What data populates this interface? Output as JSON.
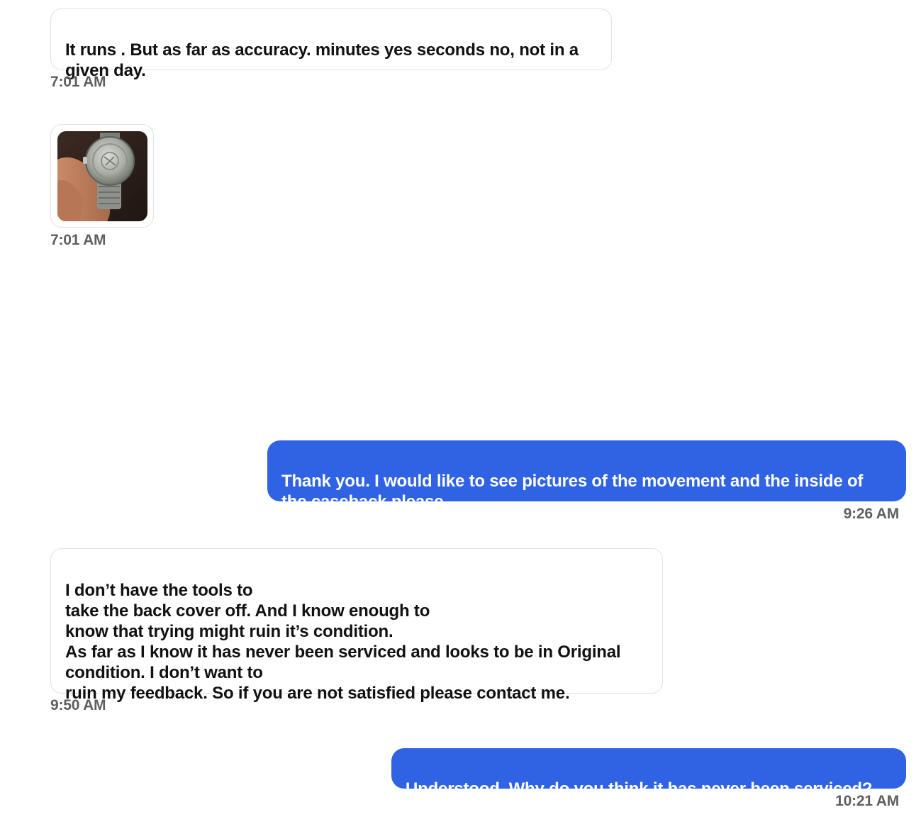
{
  "messages": [
    {
      "sender": "seller",
      "text": "It runs . But as far as accuracy. minutes yes seconds no, not in a given day.",
      "time": "7:01 AM"
    },
    {
      "sender": "seller",
      "attachment": "watch-caseback-photo",
      "time": "7:01 AM"
    },
    {
      "sender": "buyer",
      "text": "Thank you. I would like to see pictures of the movement and the inside of the caseback please.",
      "time": "9:26 AM"
    },
    {
      "sender": "seller",
      "text": "I don’t have the tools to\ntake the back cover off. And I know enough to\nknow that trying might ruin it’s condition.\n As far as I know it has never been serviced and looks to be in Original\ncondition.  I don’t want to\nruin my feedback. So if you are not satisfied please contact me.",
      "time": "9:50 AM"
    },
    {
      "sender": "buyer",
      "text": "Understood. Why do you think it has never been serviced?",
      "time": "10:21 AM"
    }
  ],
  "colors": {
    "outgoing_bubble": "#2f63e4",
    "incoming_border": "#e2e2e2",
    "timestamp": "#5f5f5f"
  }
}
